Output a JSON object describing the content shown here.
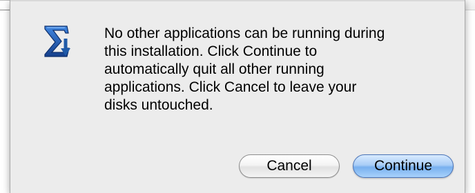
{
  "dialog": {
    "icon": "sigma-installer-icon",
    "message": "No other applications can be running during\nthis installation.  Click Continue to\nautomatically quit all other running\napplications.  Click Cancel to leave your\ndisks untouched.",
    "buttons": {
      "cancel_label": "Cancel",
      "continue_label": "Continue"
    },
    "colors": {
      "dialog_background": "#ececec",
      "default_button": "#78b0ef",
      "icon_blue": "#1f5aa8"
    }
  }
}
